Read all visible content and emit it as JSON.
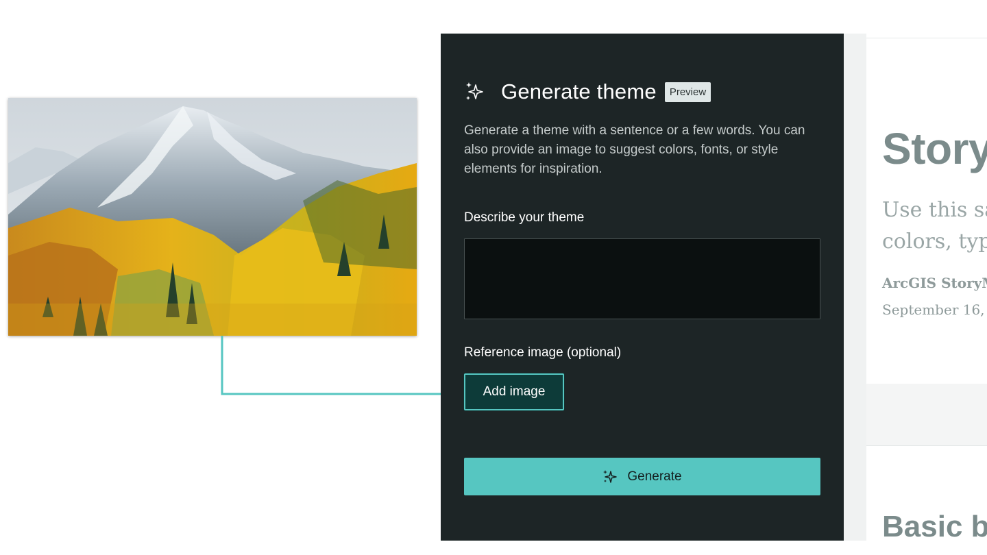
{
  "panel": {
    "title": "Generate theme",
    "badge": "Preview",
    "description": "Generate a theme with a sentence or a few words. You can also provide an image to suggest colors, fonts, or style elements for inspiration.",
    "describe_label": "Describe your theme",
    "describe_value": "",
    "reference_label": "Reference image (optional)",
    "add_image_label": "Add image",
    "generate_label": "Generate",
    "icons": {
      "header": "sparkle-icon",
      "generate": "sparkle-icon"
    },
    "colors": {
      "panel_bg": "#1d2526",
      "accent": "#56c6c1",
      "input_bg": "#0b1010"
    }
  },
  "reference_image": {
    "subject": "autumn-mountain-landscape"
  },
  "story_preview": {
    "title": "Story",
    "subtitle_line1": "Use this sa",
    "subtitle_line2": "colors, typ",
    "author": "ArcGIS StoryM",
    "date": "September 16,",
    "section_heading": "Basic b"
  }
}
